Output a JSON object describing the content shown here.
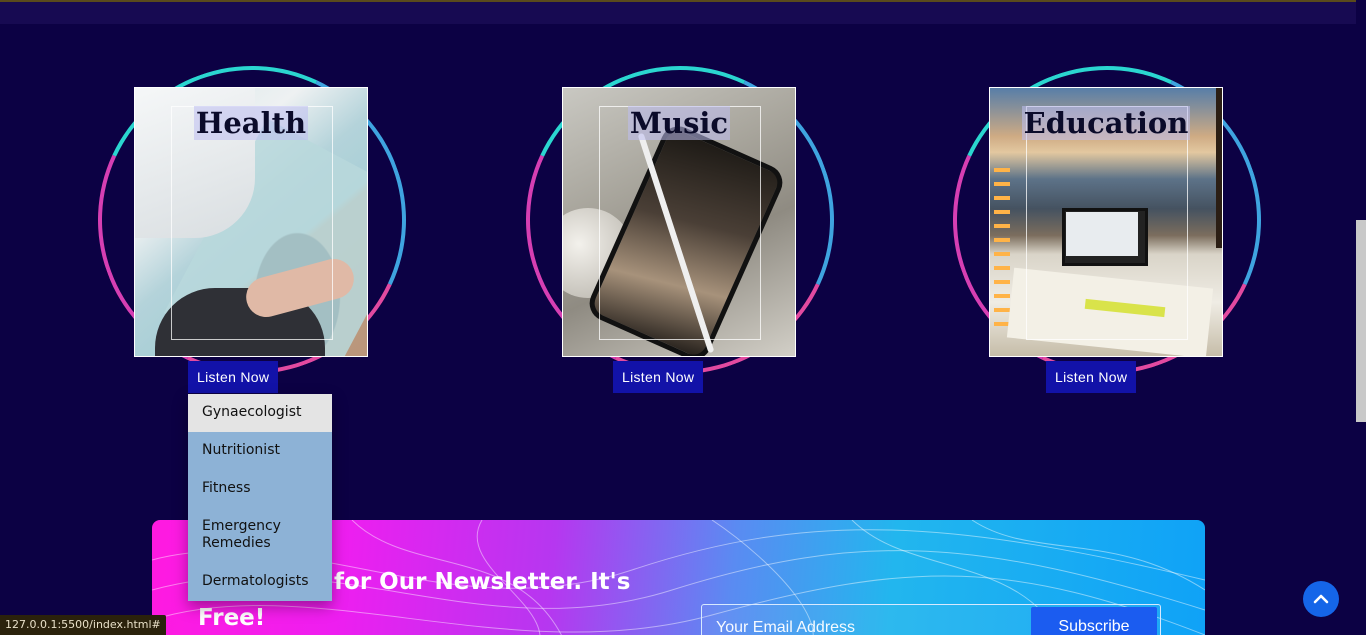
{
  "categories": [
    {
      "title": "Health",
      "button": "Listen Now"
    },
    {
      "title": "Music",
      "button": "Listen Now"
    },
    {
      "title": "Education",
      "button": "Listen Now"
    }
  ],
  "dropdown": {
    "items": [
      "Gynaecologist",
      "Nutritionist",
      "Fitness",
      "Emergency Remedies",
      "Dermatologists"
    ],
    "highlighted": "Gynaecologist"
  },
  "newsletter": {
    "title": "Subscribe for Our Newsletter. It's Free!",
    "email_placeholder": "Your Email Address",
    "subscribe_label": "Subscribe"
  },
  "status_bar": {
    "url": "127.0.0.1:5500/index.html#"
  },
  "colors": {
    "background": "#0c0144",
    "button": "#1212a8",
    "dropdown": "#8db2d6",
    "subscribe_button": "#1b5cf0",
    "scroll_top_button": "#1565e8"
  },
  "icons": {
    "scroll_top": "chevron-up-icon"
  }
}
